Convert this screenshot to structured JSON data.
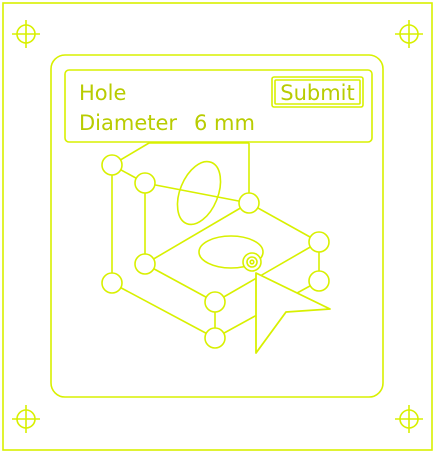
{
  "colors": {
    "stroke": "#d8f000",
    "text": "#b8cc00",
    "background": "#ffffff"
  },
  "panel": {
    "title": "Hole",
    "diameter_label": "Diameter",
    "diameter_value": "6 mm",
    "submit_label": "Submit"
  },
  "icons": {
    "crosshair": "crosshair-icon",
    "cursor": "cursor-arrow-icon",
    "target": "target-icon"
  }
}
